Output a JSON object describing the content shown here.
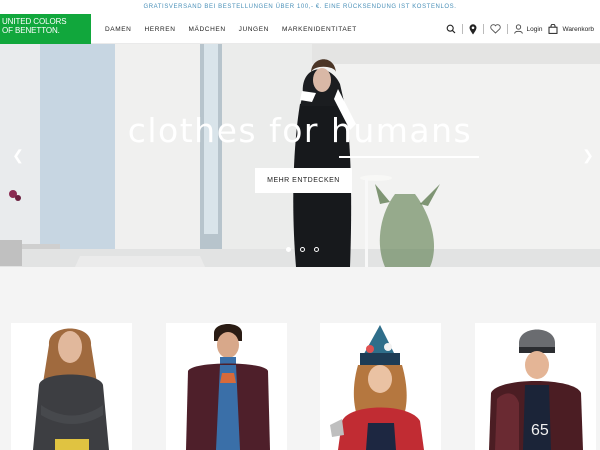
{
  "promo": {
    "text": "GRATISVERSAND BEI BESTELLUNGEN ÜBER 100,- €. EINE RÜCKSENDUNG IST KOSTENLOS."
  },
  "brand": {
    "line1": "UNITED COLORS",
    "line2": "OF BENETTON.",
    "color": "#11a73c"
  },
  "nav": {
    "items": [
      {
        "label": "DAMEN"
      },
      {
        "label": "HERREN"
      },
      {
        "label": "MÄDCHEN"
      },
      {
        "label": "JUNGEN"
      },
      {
        "label": "MARKENIDENTITAET"
      }
    ]
  },
  "tools": {
    "search_icon": "search-icon",
    "store_icon": "map-pin-icon",
    "wishlist_icon": "heart-icon",
    "login_label": "Login",
    "cart_label": "Warenkorb"
  },
  "hero": {
    "title": "clothes for humans",
    "cta_label": "MEHR ENTDECKEN",
    "slides": {
      "count": 3,
      "active": 1
    }
  },
  "products": {
    "cards": [
      {
        "name": "product-card-damen"
      },
      {
        "name": "product-card-herren"
      },
      {
        "name": "product-card-maedchen"
      },
      {
        "name": "product-card-jungen"
      }
    ]
  }
}
